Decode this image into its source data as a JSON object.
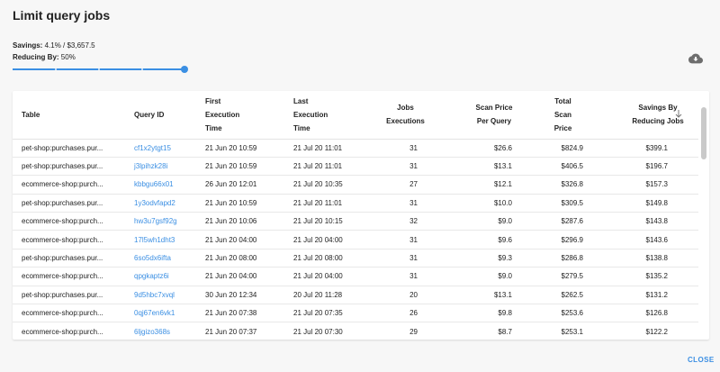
{
  "dialog": {
    "title": "Limit query jobs",
    "savings_label": "Savings:",
    "savings_value": "4.1% / $3,657.5",
    "reducing_label": "Reducing By:",
    "reducing_value": "50%",
    "slider_value_percent": 100,
    "close_label": "CLOSE"
  },
  "table": {
    "headers": {
      "table": "Table",
      "query_id": "Query ID",
      "first_exec": [
        "First",
        "Execution",
        "Time"
      ],
      "last_exec": [
        "Last",
        "Execution",
        "Time"
      ],
      "jobs": [
        "Jobs",
        "Executions"
      ],
      "scan_price": [
        "Scan Price",
        "Per Query"
      ],
      "total_scan": [
        "Total",
        "Scan",
        "Price"
      ],
      "savings": [
        "Savings By",
        "Reducing Jobs"
      ]
    },
    "rows": [
      {
        "table": "pet-shop:purchases.pur...",
        "qid": "cf1x2ytgt15",
        "first": "21 Jun 20 10:59",
        "last": "21 Jul 20 11:01",
        "jobs": "31",
        "scan": "$26.6",
        "total": "$824.9",
        "sav": "$399.1"
      },
      {
        "table": "pet-shop:purchases.pur...",
        "qid": "j3lpihzk28i",
        "first": "21 Jun 20 10:59",
        "last": "21 Jul 20 11:01",
        "jobs": "31",
        "scan": "$13.1",
        "total": "$406.5",
        "sav": "$196.7"
      },
      {
        "table": "ecommerce-shop:purch...",
        "qid": "kbbgu66x01",
        "first": "26 Jun 20 12:01",
        "last": "21 Jul 20 10:35",
        "jobs": "27",
        "scan": "$12.1",
        "total": "$326.8",
        "sav": "$157.3"
      },
      {
        "table": "pet-shop:purchases.pur...",
        "qid": "1y3odvfapd2",
        "first": "21 Jun 20 10:59",
        "last": "21 Jul 20 11:01",
        "jobs": "31",
        "scan": "$10.0",
        "total": "$309.5",
        "sav": "$149.8"
      },
      {
        "table": "ecommerce-shop:purch...",
        "qid": "hw3u7gsf92g",
        "first": "21 Jun 20 10:06",
        "last": "21 Jul 20 10:15",
        "jobs": "32",
        "scan": "$9.0",
        "total": "$287.6",
        "sav": "$143.8"
      },
      {
        "table": "ecommerce-shop:purch...",
        "qid": "17l5wh1dht3",
        "first": "21 Jun 20 04:00",
        "last": "21 Jul 20 04:00",
        "jobs": "31",
        "scan": "$9.6",
        "total": "$296.9",
        "sav": "$143.6"
      },
      {
        "table": "pet-shop:purchases.pur...",
        "qid": "6so5dx6ifta",
        "first": "21 Jun 20 08:00",
        "last": "21 Jul 20 08:00",
        "jobs": "31",
        "scan": "$9.3",
        "total": "$286.8",
        "sav": "$138.8"
      },
      {
        "table": "ecommerce-shop:purch...",
        "qid": "qpgkaptz6i",
        "first": "21 Jun 20 04:00",
        "last": "21 Jul 20 04:00",
        "jobs": "31",
        "scan": "$9.0",
        "total": "$279.5",
        "sav": "$135.2"
      },
      {
        "table": "pet-shop:purchases.pur...",
        "qid": "9d5hbc7xvql",
        "first": "30 Jun 20 12:34",
        "last": "20 Jul 20 11:28",
        "jobs": "20",
        "scan": "$13.1",
        "total": "$262.5",
        "sav": "$131.2"
      },
      {
        "table": "ecommerce-shop:purch...",
        "qid": "0qj67en6vk1",
        "first": "21 Jun 20 07:38",
        "last": "21 Jul 20 07:35",
        "jobs": "26",
        "scan": "$9.8",
        "total": "$253.6",
        "sav": "$126.8"
      },
      {
        "table": "ecommerce-shop:purch...",
        "qid": "6ljgizo368s",
        "first": "21 Jun 20 07:37",
        "last": "21 Jul 20 07:30",
        "jobs": "29",
        "scan": "$8.7",
        "total": "$253.1",
        "sav": "$122.2"
      }
    ]
  },
  "colors": {
    "accent": "#3b8fe3",
    "background": "#f7f7f7"
  },
  "icons": {
    "download": "cloud-download-icon",
    "sort": "arrow-down-icon"
  }
}
